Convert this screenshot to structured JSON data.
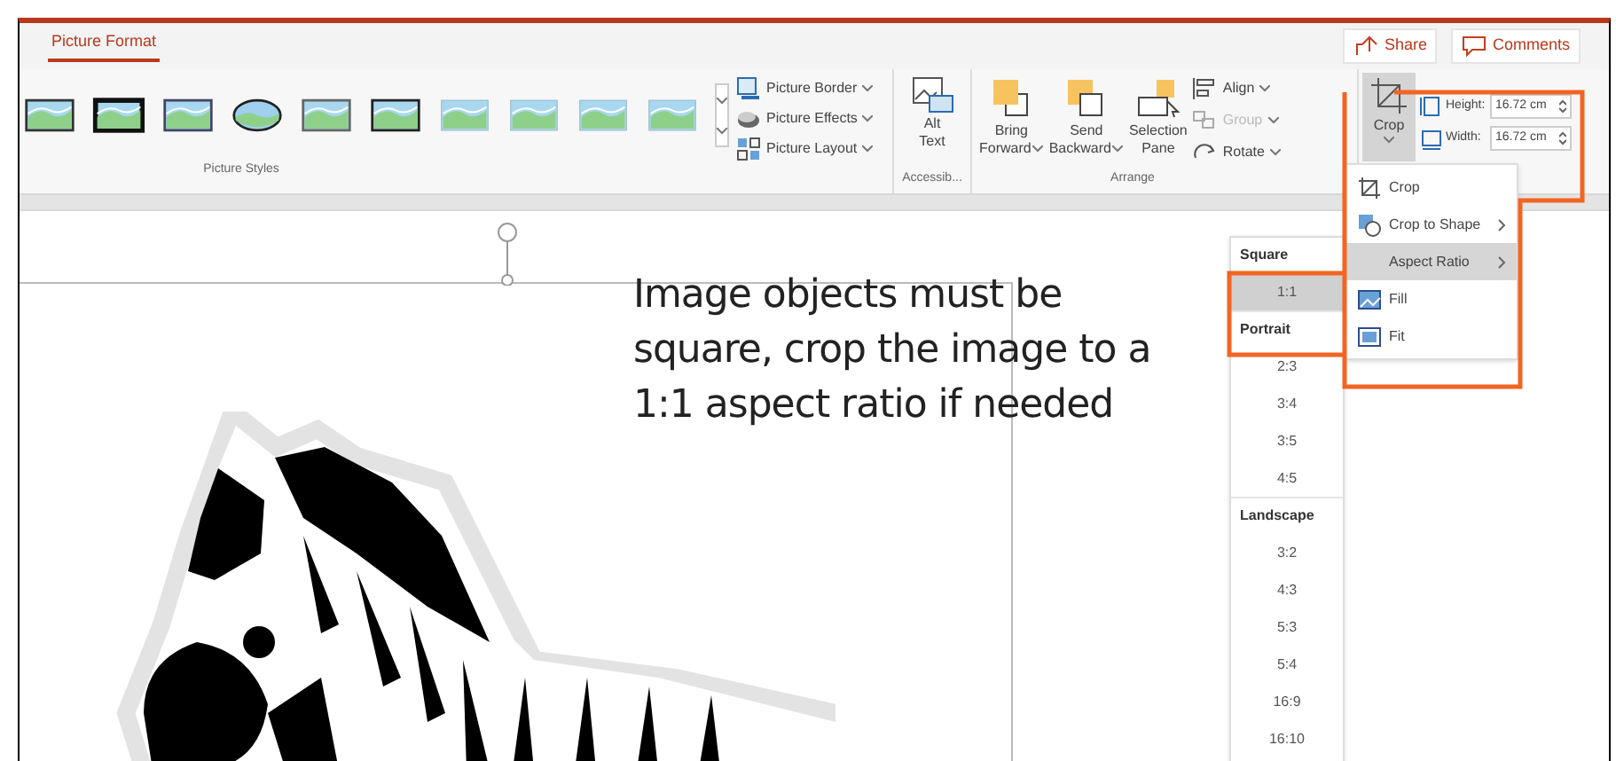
{
  "tabs": [
    {
      "label": "Picture Format",
      "selected": true
    }
  ],
  "header_buttons": [
    {
      "label": "Share",
      "kind": "share"
    },
    {
      "label": "Comments",
      "kind": "comments"
    }
  ],
  "picture_commands": [
    {
      "label": "Picture Border",
      "kind": "border"
    },
    {
      "label": "Picture Effects",
      "kind": "effects"
    },
    {
      "label": "Picture Layout",
      "kind": "layout"
    }
  ],
  "alt_text": {
    "lines": [
      "Alt",
      "Text"
    ]
  },
  "arrange_buttons": [
    {
      "lines": [
        "Bring",
        "Forward"
      ],
      "kind": "forward"
    },
    {
      "lines": [
        "Send",
        "Backward"
      ],
      "kind": "backward"
    },
    {
      "lines": [
        "Selection",
        "Pane"
      ],
      "kind": "pane"
    }
  ],
  "arrange_commands": [
    {
      "label": "Align",
      "kind": "align",
      "disabled": false
    },
    {
      "label": "Group",
      "kind": "group",
      "disabled": true
    },
    {
      "label": "Rotate",
      "kind": "rotate",
      "disabled": false
    }
  ],
  "crop_button": {
    "label": "Crop",
    "selected": true
  },
  "size_fields": [
    {
      "label": "Height:",
      "value": "16.72 cm",
      "kind": "height"
    },
    {
      "label": "Width:",
      "value": "16.72 cm",
      "kind": "width"
    }
  ],
  "group_labels": [
    {
      "label": "Picture Styles",
      "kind": "styles"
    },
    {
      "label": "Accessib...",
      "kind": "access"
    },
    {
      "label": "Arrange",
      "kind": "arrange"
    }
  ],
  "crop_menu": [
    {
      "label": "Crop",
      "kind": "crop",
      "submenu": false,
      "selected": false
    },
    {
      "label": "Crop to Shape",
      "kind": "shape",
      "submenu": true,
      "selected": false
    },
    {
      "label": "Aspect Ratio",
      "kind": "none",
      "submenu": true,
      "selected": true
    },
    {
      "label": "Fill",
      "kind": "fill",
      "submenu": false,
      "selected": false
    },
    {
      "label": "Fit",
      "kind": "fit",
      "submenu": false,
      "selected": false
    }
  ],
  "aspect_menu": [
    {
      "header": "Square",
      "items": [
        {
          "label": "1:1",
          "selected": true
        }
      ]
    },
    {
      "header": "Portrait",
      "items": [
        {
          "label": "2:3",
          "selected": false
        },
        {
          "label": "3:4",
          "selected": false
        },
        {
          "label": "3:5",
          "selected": false
        },
        {
          "label": "4:5",
          "selected": false
        }
      ]
    },
    {
      "header": "Landscape",
      "items": [
        {
          "label": "3:2",
          "selected": false
        },
        {
          "label": "4:3",
          "selected": false
        },
        {
          "label": "5:3",
          "selected": false
        },
        {
          "label": "5:4",
          "selected": false
        },
        {
          "label": "16:9",
          "selected": false
        },
        {
          "label": "16:10",
          "selected": false
        }
      ]
    }
  ],
  "note": "Image objects must be square, crop the image to a 1:1 aspect ratio if needed"
}
